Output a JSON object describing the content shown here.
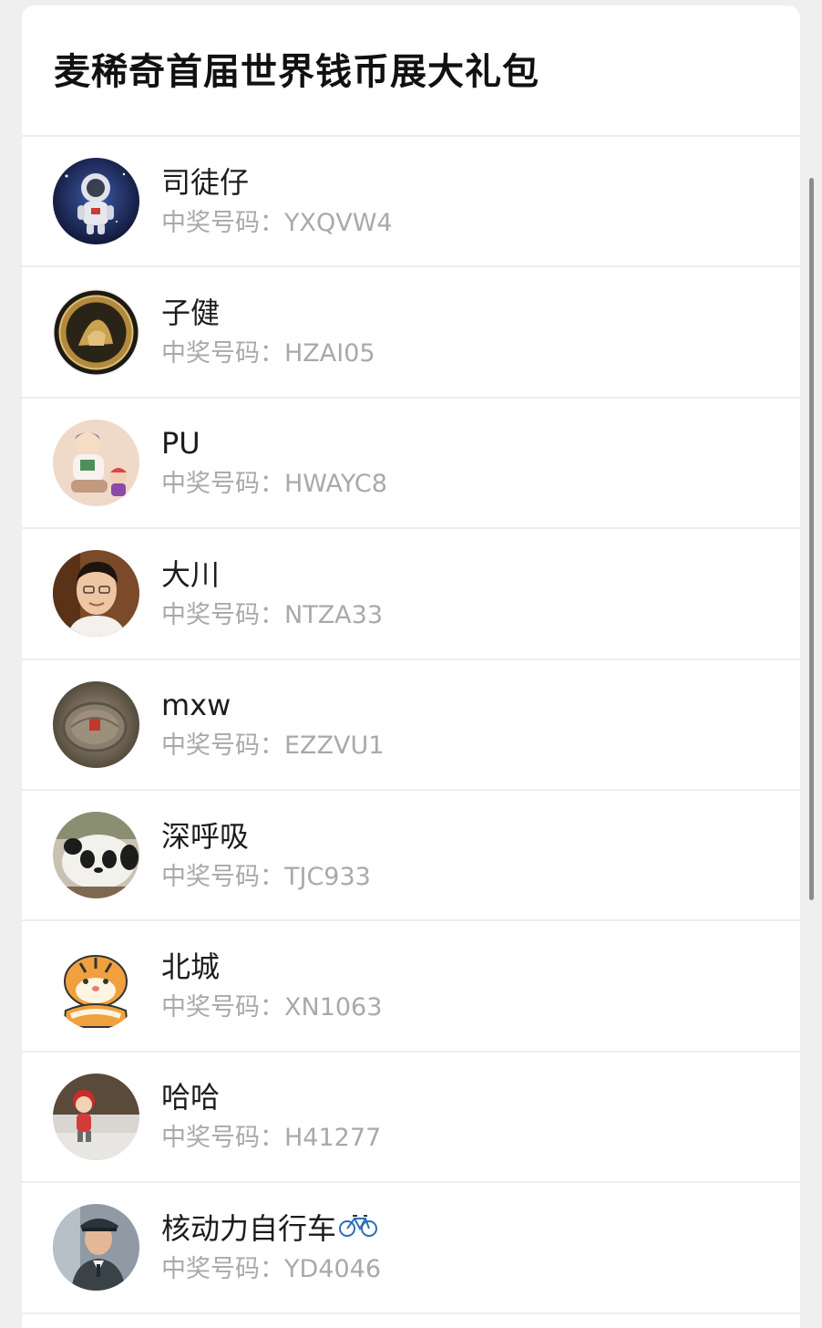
{
  "title": "麦稀奇首届世界钱币展大礼包",
  "code_prefix": "中奖号码：",
  "winners": [
    {
      "name": "司徒仔",
      "code": "YXQVW4",
      "avatar_icon": "astronaut-avatar-icon"
    },
    {
      "name": "子健",
      "code": "HZAI05",
      "avatar_icon": "gold-coin-avatar-icon"
    },
    {
      "name": "PU",
      "code": "HWAYC8",
      "avatar_icon": "cartoon-family-avatar-icon"
    },
    {
      "name": "大川",
      "code": "NTZA33",
      "avatar_icon": "person-photo-avatar-icon"
    },
    {
      "name": "mxw",
      "code": "EZZVU1",
      "avatar_icon": "coin-closeup-avatar-icon"
    },
    {
      "name": "深呼吸",
      "code": "TJC933",
      "avatar_icon": "panda-avatar-icon"
    },
    {
      "name": "北城",
      "code": "XN1063",
      "avatar_icon": "tiger-avatar-icon"
    },
    {
      "name": "哈哈",
      "code": "H41277",
      "avatar_icon": "toy-figure-avatar-icon"
    },
    {
      "name": "核动力自行车",
      "code": "YD4046",
      "avatar_icon": "officer-avatar-icon",
      "name_icon": "bicycle-icon"
    }
  ]
}
